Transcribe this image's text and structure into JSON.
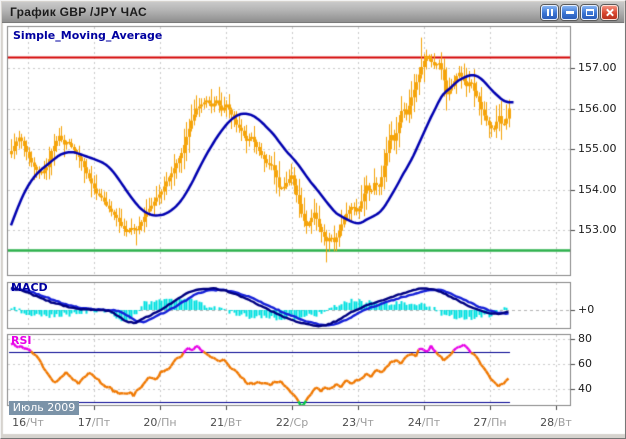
{
  "window": {
    "title": "График GBP /JPY ЧАС",
    "buttons": [
      "pause",
      "minimize",
      "maximize",
      "close"
    ]
  },
  "chart_data": {
    "type": "candlestick",
    "title": "График GBP /JPY ЧАС",
    "instrument": "GBP /JPY",
    "timeframe": "ЧАС",
    "panels": {
      "price": {
        "indicator_label": "Simple_Moving_Average",
        "y_ticks": [
          "157.00",
          "156.00",
          "155.00",
          "154.00",
          "153.00"
        ],
        "y_tick_values": [
          157,
          156,
          155,
          154,
          153
        ],
        "resistance_level": 157.25,
        "support_level": 152.49,
        "sma_period": 24,
        "candle_count": 200,
        "price_keyframes": [
          [
            10,
            154.95
          ],
          [
            14,
            155.15
          ],
          [
            18,
            155.3
          ],
          [
            23,
            155.05
          ],
          [
            28,
            154.75
          ],
          [
            34,
            154.5
          ],
          [
            40,
            154.4
          ],
          [
            45,
            154.55
          ],
          [
            50,
            154.95
          ],
          [
            55,
            155.2
          ],
          [
            58,
            155.35
          ],
          [
            62,
            155.1
          ],
          [
            66,
            155.2
          ],
          [
            70,
            155.05
          ],
          [
            75,
            154.9
          ],
          [
            80,
            154.7
          ],
          [
            85,
            154.4
          ],
          [
            90,
            154.15
          ],
          [
            95,
            153.9
          ],
          [
            100,
            153.8
          ],
          [
            105,
            153.6
          ],
          [
            110,
            153.45
          ],
          [
            115,
            153.3
          ],
          [
            120,
            153.1
          ],
          [
            125,
            152.95
          ],
          [
            130,
            153.05
          ],
          [
            135,
            153.0
          ],
          [
            140,
            153.2
          ],
          [
            145,
            153.45
          ],
          [
            150,
            153.6
          ],
          [
            155,
            153.8
          ],
          [
            160,
            153.95
          ],
          [
            165,
            154.2
          ],
          [
            170,
            154.4
          ],
          [
            175,
            154.65
          ],
          [
            180,
            154.9
          ],
          [
            185,
            155.3
          ],
          [
            190,
            155.7
          ],
          [
            195,
            156.0
          ],
          [
            200,
            156.1
          ],
          [
            205,
            156.2
          ],
          [
            210,
            156.05
          ],
          [
            215,
            156.2
          ],
          [
            220,
            155.95
          ],
          [
            225,
            156.1
          ],
          [
            230,
            155.85
          ],
          [
            235,
            155.6
          ],
          [
            240,
            155.45
          ],
          [
            245,
            155.2
          ],
          [
            250,
            155.3
          ],
          [
            255,
            155.05
          ],
          [
            260,
            154.85
          ],
          [
            265,
            154.65
          ],
          [
            270,
            154.6
          ],
          [
            274,
            154.4
          ],
          [
            278,
            154.0
          ],
          [
            282,
            154.05
          ],
          [
            286,
            154.2
          ],
          [
            290,
            154.35
          ],
          [
            294,
            153.95
          ],
          [
            298,
            153.6
          ],
          [
            301,
            153.3
          ],
          [
            305,
            153.1
          ],
          [
            309,
            153.25
          ],
          [
            313,
            153.45
          ],
          [
            317,
            153.1
          ],
          [
            321,
            152.9
          ],
          [
            325,
            152.72
          ],
          [
            329,
            152.85
          ],
          [
            333,
            152.68
          ],
          [
            337,
            152.95
          ],
          [
            341,
            153.2
          ],
          [
            346,
            153.45
          ],
          [
            351,
            153.6
          ],
          [
            356,
            153.42
          ],
          [
            361,
            153.78
          ],
          [
            365,
            154.1
          ],
          [
            369,
            153.9
          ],
          [
            373,
            154.2
          ],
          [
            377,
            154.02
          ],
          [
            381,
            154.4
          ],
          [
            385,
            154.9
          ],
          [
            389,
            155.4
          ],
          [
            393,
            155.18
          ],
          [
            397,
            155.6
          ],
          [
            401,
            156.05
          ],
          [
            405,
            155.85
          ],
          [
            409,
            156.2
          ],
          [
            413,
            156.5
          ],
          [
            417,
            156.8
          ],
          [
            421,
            157.1
          ],
          [
            425,
            157.3
          ],
          [
            429,
            157.18
          ],
          [
            433,
            157.05
          ],
          [
            437,
            157.15
          ],
          [
            441,
            156.9
          ],
          [
            445,
            156.35
          ],
          [
            449,
            156.5
          ],
          [
            453,
            156.7
          ],
          [
            457,
            156.9
          ],
          [
            461,
            156.75
          ],
          [
            465,
            156.55
          ],
          [
            469,
            156.7
          ],
          [
            473,
            156.4
          ],
          [
            477,
            156.2
          ],
          [
            481,
            155.9
          ],
          [
            485,
            155.7
          ],
          [
            489,
            155.52
          ],
          [
            493,
            155.5
          ],
          [
            497,
            155.85
          ],
          [
            501,
            155.55
          ],
          [
            505,
            155.75
          ],
          [
            508,
            156.05
          ]
        ],
        "wick_spikes": [
          {
            "x": 421,
            "high": 157.75
          },
          {
            "x": 457,
            "high": 157.05
          },
          {
            "x": 210,
            "high": 156.48
          },
          {
            "x": 58,
            "high": 155.52
          },
          {
            "x": 325,
            "low": 152.2
          },
          {
            "x": 136,
            "low": 152.62
          }
        ]
      },
      "macd": {
        "label": "MACD",
        "zero_label": "+0",
        "keyframes": [
          [
            10,
            0.55
          ],
          [
            22,
            0.48
          ],
          [
            36,
            0.34
          ],
          [
            52,
            0.18
          ],
          [
            68,
            0.07
          ],
          [
            80,
            0.02
          ],
          [
            95,
            0.01
          ],
          [
            108,
            -0.02
          ],
          [
            118,
            -0.16
          ],
          [
            126,
            -0.3
          ],
          [
            134,
            -0.32
          ],
          [
            142,
            -0.22
          ],
          [
            150,
            -0.12
          ],
          [
            158,
            -0.02
          ],
          [
            166,
            0.1
          ],
          [
            176,
            0.26
          ],
          [
            186,
            0.42
          ],
          [
            198,
            0.52
          ],
          [
            212,
            0.54
          ],
          [
            225,
            0.48
          ],
          [
            240,
            0.34
          ],
          [
            255,
            0.16
          ],
          [
            268,
            0.0
          ],
          [
            278,
            -0.12
          ],
          [
            290,
            -0.24
          ],
          [
            302,
            -0.34
          ],
          [
            315,
            -0.4
          ],
          [
            325,
            -0.38
          ],
          [
            335,
            -0.28
          ],
          [
            345,
            -0.14
          ],
          [
            353,
            -0.02
          ],
          [
            362,
            0.08
          ],
          [
            375,
            0.2
          ],
          [
            390,
            0.32
          ],
          [
            405,
            0.44
          ],
          [
            420,
            0.54
          ],
          [
            432,
            0.53
          ],
          [
            444,
            0.4
          ],
          [
            456,
            0.25
          ],
          [
            468,
            0.1
          ],
          [
            478,
            0.0
          ],
          [
            488,
            -0.08
          ],
          [
            498,
            -0.1
          ],
          [
            508,
            -0.04
          ]
        ]
      },
      "rsi": {
        "label": "RSI",
        "y_ticks": [
          "80",
          "60",
          "40"
        ],
        "y_tick_values": [
          80,
          60,
          40
        ],
        "upper_threshold": 70,
        "lower_threshold": 30,
        "keyframes": [
          [
            10,
            76
          ],
          [
            16,
            75
          ],
          [
            22,
            73
          ],
          [
            28,
            71
          ],
          [
            34,
            68
          ],
          [
            40,
            61
          ],
          [
            46,
            52
          ],
          [
            52,
            45
          ],
          [
            57,
            47
          ],
          [
            62,
            51
          ],
          [
            66,
            53
          ],
          [
            71,
            49
          ],
          [
            77,
            44
          ],
          [
            83,
            50
          ],
          [
            88,
            53
          ],
          [
            94,
            49
          ],
          [
            100,
            45
          ],
          [
            106,
            42
          ],
          [
            112,
            39
          ],
          [
            118,
            36
          ],
          [
            124,
            35
          ],
          [
            129,
            37
          ],
          [
            133,
            35
          ],
          [
            139,
            41
          ],
          [
            145,
            47
          ],
          [
            150,
            49
          ],
          [
            155,
            47
          ],
          [
            160,
            53
          ],
          [
            165,
            56
          ],
          [
            170,
            58
          ],
          [
            175,
            63
          ],
          [
            180,
            66
          ],
          [
            184,
            70
          ],
          [
            188,
            73
          ],
          [
            192,
            71
          ],
          [
            196,
            75
          ],
          [
            200,
            72
          ],
          [
            205,
            68
          ],
          [
            211,
            66
          ],
          [
            217,
            62
          ],
          [
            222,
            64
          ],
          [
            228,
            58
          ],
          [
            234,
            54
          ],
          [
            240,
            49
          ],
          [
            246,
            45
          ],
          [
            252,
            44
          ],
          [
            258,
            46
          ],
          [
            264,
            44
          ],
          [
            270,
            43
          ],
          [
            276,
            47
          ],
          [
            281,
            45
          ],
          [
            286,
            41
          ],
          [
            291,
            37
          ],
          [
            296,
            31
          ],
          [
            300,
            26
          ],
          [
            304,
            30
          ],
          [
            308,
            35
          ],
          [
            312,
            39
          ],
          [
            316,
            41
          ],
          [
            320,
            38
          ],
          [
            325,
            42
          ],
          [
            330,
            40
          ],
          [
            335,
            44
          ],
          [
            340,
            42
          ],
          [
            345,
            46
          ],
          [
            350,
            44
          ],
          [
            355,
            48
          ],
          [
            360,
            47
          ],
          [
            365,
            52
          ],
          [
            370,
            50
          ],
          [
            375,
            54
          ],
          [
            380,
            53
          ],
          [
            385,
            58
          ],
          [
            390,
            61
          ],
          [
            395,
            63
          ],
          [
            400,
            61
          ],
          [
            405,
            65
          ],
          [
            410,
            68
          ],
          [
            414,
            66
          ],
          [
            418,
            71
          ],
          [
            422,
            73
          ],
          [
            426,
            70
          ],
          [
            430,
            74
          ],
          [
            434,
            71
          ],
          [
            438,
            67
          ],
          [
            442,
            63
          ],
          [
            446,
            65
          ],
          [
            450,
            69
          ],
          [
            454,
            72
          ],
          [
            458,
            74
          ],
          [
            462,
            76
          ],
          [
            466,
            73
          ],
          [
            470,
            70
          ],
          [
            474,
            67
          ],
          [
            478,
            63
          ],
          [
            482,
            58
          ],
          [
            486,
            53
          ],
          [
            490,
            49
          ],
          [
            494,
            45
          ],
          [
            498,
            42
          ],
          [
            502,
            44
          ],
          [
            506,
            48
          ],
          [
            510,
            51
          ]
        ]
      }
    },
    "x_axis": {
      "month_label": "Июль 2009",
      "day_labels": [
        {
          "d": "16",
          "w": "Чт"
        },
        {
          "d": "17",
          "w": "Пт"
        },
        {
          "d": "20",
          "w": "Пн"
        },
        {
          "d": "21",
          "w": "Вт"
        },
        {
          "d": "22",
          "w": "Ср"
        },
        {
          "d": "23",
          "w": "Чт"
        },
        {
          "d": "24",
          "w": "Пт"
        },
        {
          "d": "27",
          "w": "Пн"
        },
        {
          "d": "28",
          "w": "Вт"
        }
      ]
    },
    "colors": {
      "candle": "#f5a40a",
      "sma": "#0000b0",
      "resistance": "#d40000",
      "support": "#2ab04a",
      "macd_line": "#000080",
      "macd_signal": "#1520d8",
      "macd_hist": "#00e0e0",
      "rsi_line": "#f07800",
      "rsi_overbought": "#e800e8",
      "rsi_oversold": "#00cc44",
      "rsi_threshold": "#000090",
      "grid": "#cbcbcb",
      "panel_border": "#848484"
    }
  }
}
